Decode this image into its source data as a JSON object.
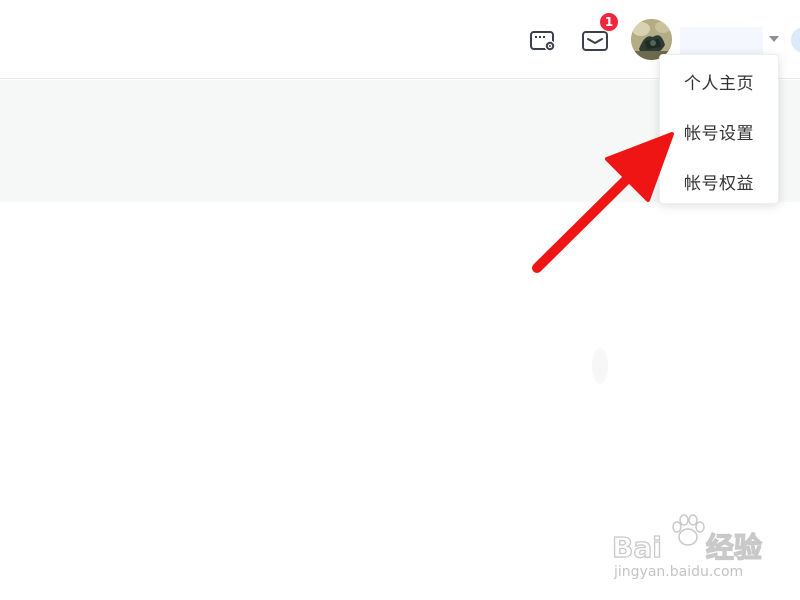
{
  "header": {
    "admin_icon": "card-gear-icon",
    "mail_icon": "mail-icon",
    "notification_count": "1",
    "avatar_icon": "user-avatar",
    "username": "",
    "caret_icon": "caret-down-icon"
  },
  "user_menu": {
    "items": [
      {
        "label": "个人主页"
      },
      {
        "label": "帐号设置"
      },
      {
        "label": "帐号权益"
      }
    ]
  },
  "annotation": {
    "type": "red-arrow",
    "points_to": "帐号设置",
    "color": "#f01515"
  },
  "watermark": {
    "logo_text_left": "Bai",
    "logo_text_right": "经验",
    "subtitle": "jingyan.baidu.com"
  },
  "colors": {
    "badge": "#f0263d",
    "banner_background": "#f6f8f8",
    "arrow": "#f01515",
    "menu_text": "#333333"
  }
}
